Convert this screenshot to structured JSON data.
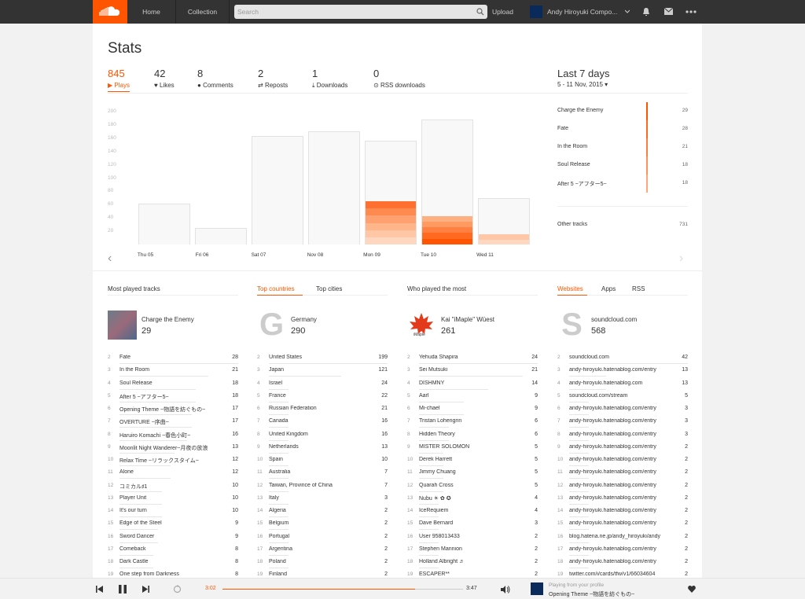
{
  "nav": {
    "home": "Home",
    "collection": "Collection",
    "search_placeholder": "Search",
    "upload": "Upload",
    "user": "Andy Hiroyuki Compo..."
  },
  "colors": {
    "accent": "#ff5500",
    "topbar": "#333333"
  },
  "icons": [
    "soundcloud-logo",
    "search-icon",
    "chevron-down-icon",
    "bell-icon",
    "mail-icon",
    "more-icon"
  ],
  "page": {
    "title": "Stats"
  },
  "stats": [
    {
      "value": "845",
      "label": "Plays",
      "active": true
    },
    {
      "value": "42",
      "label": "Likes"
    },
    {
      "value": "8",
      "label": "Comments"
    },
    {
      "value": "2",
      "label": "Reposts"
    },
    {
      "value": "1",
      "label": "Downloads"
    },
    {
      "value": "0",
      "label": "RSS downloads"
    }
  ],
  "range": {
    "title": "Last 7 days",
    "subtitle": "5 - 11 Nov, 2015 ▾"
  },
  "chart_data": {
    "type": "bar",
    "categories": [
      "Thu 05",
      "Fri 06",
      "Sat 07",
      "Nov 08",
      "Mon 09",
      "Tue 10",
      "Wed 11"
    ],
    "values": [
      62,
      25,
      163,
      171,
      156,
      188,
      70
    ],
    "highlight": [
      0,
      0,
      0,
      0,
      65,
      43,
      15
    ],
    "yticks": [
      20,
      40,
      60,
      80,
      100,
      120,
      140,
      160,
      180,
      200
    ],
    "ylim": [
      0,
      200
    ],
    "grid": false
  },
  "top_tracks_side": [
    {
      "name": "Charge the Enemy",
      "value": "29"
    },
    {
      "name": "Fate",
      "value": "28"
    },
    {
      "name": "In the Room",
      "value": "21"
    },
    {
      "name": "Soul Release",
      "value": "18"
    },
    {
      "name": "After 5 ~アフター5~",
      "value": "18"
    },
    {
      "name": "Other tracks",
      "value": "731"
    }
  ],
  "columns": {
    "tracks": {
      "header": "Most played tracks",
      "feat_name": "Charge the Enemy",
      "feat_count": "29",
      "rows": [
        [
          "2",
          "Fate",
          "28"
        ],
        [
          "3",
          "In the Room",
          "21"
        ],
        [
          "4",
          "Soul Release",
          "18"
        ],
        [
          "5",
          "After 5 ~アフター5~",
          "18"
        ],
        [
          "6",
          "Opening Theme ~物語を紡ぐもの~",
          "17"
        ],
        [
          "7",
          "OVERTURE ~序曲~",
          "17"
        ],
        [
          "8",
          "Haruiro Komachi ~春色小町~",
          "16"
        ],
        [
          "9",
          "Moonlit Night Wanderer~月夜の放浪",
          "13"
        ],
        [
          "10",
          "Relax Time ~リラックスタイム~",
          "12"
        ],
        [
          "11",
          "Alone",
          "12"
        ],
        [
          "12",
          "コミカル♯1",
          "10"
        ],
        [
          "13",
          "Player Unit",
          "10"
        ],
        [
          "14",
          "It's our turn",
          "10"
        ],
        [
          "15",
          "Edge of the Steel",
          "9"
        ],
        [
          "16",
          "Sword Dancer",
          "9"
        ],
        [
          "17",
          "Comeback",
          "8"
        ],
        [
          "18",
          "Dark Castle",
          "8"
        ],
        [
          "19",
          "One step from Darkness",
          "8"
        ]
      ]
    },
    "countries": {
      "tab1": "Top countries",
      "tab2": "Top cities",
      "letter": "G",
      "feat_name": "Germany",
      "feat_count": "290",
      "rows": [
        [
          "2",
          "United States",
          "199"
        ],
        [
          "3",
          "Japan",
          "121"
        ],
        [
          "4",
          "Israel",
          "24"
        ],
        [
          "5",
          "France",
          "22"
        ],
        [
          "6",
          "Russian Federation",
          "21"
        ],
        [
          "7",
          "Canada",
          "16"
        ],
        [
          "8",
          "United Kingdom",
          "16"
        ],
        [
          "9",
          "Netherlands",
          "13"
        ],
        [
          "10",
          "Spain",
          "10"
        ],
        [
          "11",
          "Australia",
          "7"
        ],
        [
          "12",
          "Taiwan, Province of China",
          "7"
        ],
        [
          "13",
          "Italy",
          "3"
        ],
        [
          "14",
          "Algeria",
          "2"
        ],
        [
          "15",
          "Belgium",
          "2"
        ],
        [
          "16",
          "Portugal",
          "2"
        ],
        [
          "17",
          "Argentina",
          "2"
        ],
        [
          "18",
          "Poland",
          "2"
        ],
        [
          "19",
          "Finland",
          "2"
        ]
      ]
    },
    "listeners": {
      "header": "Who played the most",
      "feat_name": "Kai \"iMaple\" Wüest",
      "feat_count": "261",
      "feat_logo": "iMaple",
      "rows": [
        [
          "2",
          "Yehuda Shapira",
          "24"
        ],
        [
          "3",
          "Sei Mutsuki",
          "21"
        ],
        [
          "4",
          "DISHMNY",
          "14"
        ],
        [
          "5",
          "Aarl",
          "9"
        ],
        [
          "6",
          "Mi-chael",
          "9"
        ],
        [
          "7",
          "Tristan Lohengrin",
          "6"
        ],
        [
          "8",
          "Hidden Theory",
          "6"
        ],
        [
          "9",
          "MISTER SOLOMON",
          "5"
        ],
        [
          "10",
          "Derek Harrett",
          "5"
        ],
        [
          "11",
          "Jimmy Chuang",
          "5"
        ],
        [
          "12",
          "Quarah Cross",
          "5"
        ],
        [
          "13",
          "Nubu ☀ ✿ ✪",
          "4"
        ],
        [
          "14",
          "IceRequiem",
          "4"
        ],
        [
          "15",
          "Dave Bernard",
          "3"
        ],
        [
          "16",
          "User 958013433",
          "2"
        ],
        [
          "17",
          "Stephen Mannion",
          "2"
        ],
        [
          "18",
          "Holland Albright ♬",
          "2"
        ],
        [
          "19",
          "ESCAPER**",
          "2"
        ]
      ]
    },
    "websites": {
      "tab1": "Websites",
      "tab2": "Apps",
      "tab3": "RSS",
      "letter": "S",
      "feat_name": "soundcloud.com",
      "feat_count": "568",
      "rows": [
        [
          "2",
          "soundcloud.com",
          "42"
        ],
        [
          "3",
          "andy-hiroyuki.hatenablog.com/entry",
          "13"
        ],
        [
          "4",
          "andy-hiroyuki.hatenablog.com",
          "13"
        ],
        [
          "5",
          "soundcloud.com/stream",
          "5"
        ],
        [
          "6",
          "andy-hiroyuki.hatenablog.com/entry",
          "3"
        ],
        [
          "7",
          "andy-hiroyuki.hatenablog.com/entry",
          "3"
        ],
        [
          "8",
          "andy-hiroyuki.hatenablog.com/entry",
          "3"
        ],
        [
          "9",
          "andy-hiroyuki.hatenablog.com/entry",
          "2"
        ],
        [
          "10",
          "andy-hiroyuki.hatenablog.com/entry",
          "2"
        ],
        [
          "11",
          "andy-hiroyuki.hatenablog.com/entry",
          "2"
        ],
        [
          "12",
          "andy-hiroyuki.hatenablog.com/entry",
          "2"
        ],
        [
          "13",
          "andy-hiroyuki.hatenablog.com/entry",
          "2"
        ],
        [
          "14",
          "andy-hiroyuki.hatenablog.com/entry",
          "2"
        ],
        [
          "15",
          "andy-hiroyuki.hatenablog.com/entry",
          "2"
        ],
        [
          "16",
          "blog.hatena.ne.jp/andy_hiroyuki/andy",
          "2"
        ],
        [
          "17",
          "andy-hiroyuki.hatenablog.com/entry",
          "2"
        ],
        [
          "18",
          "andy-hiroyuki.hatenablog.com/entry",
          "2"
        ],
        [
          "19",
          "twitter.com/i/cards/tfw/v1/66034604",
          "2"
        ]
      ]
    }
  },
  "player": {
    "elapsed": "3:02",
    "duration": "3:47",
    "progress": 0.8,
    "from": "Playing from your profile",
    "title": "Opening Theme ~物語を紡ぐもの~"
  }
}
